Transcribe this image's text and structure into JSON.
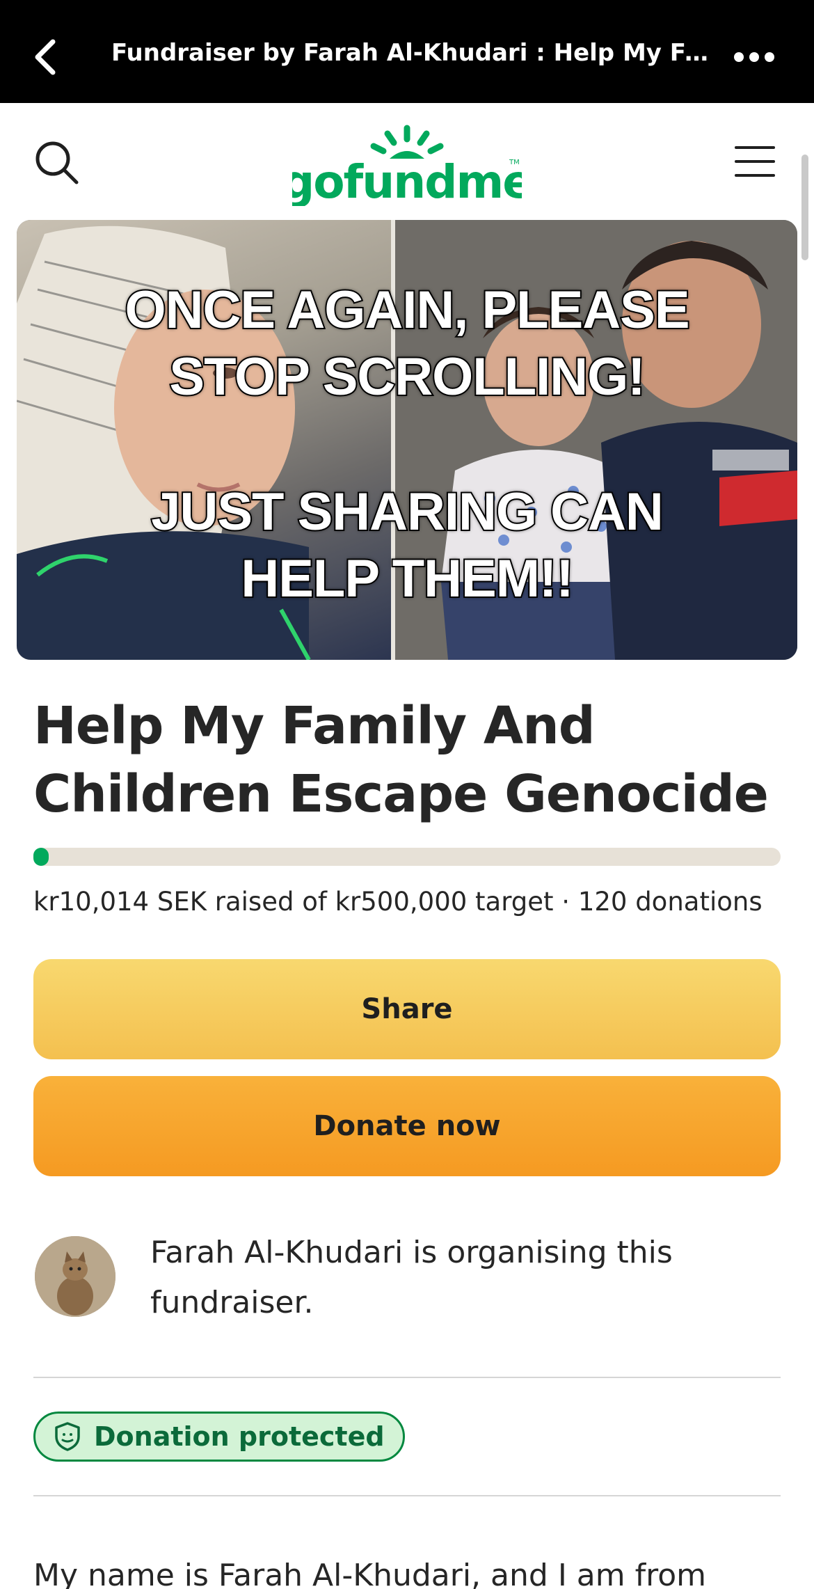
{
  "browser_bar": {
    "title": "Fundraiser by Farah Al-Khudari : Help My Fami...",
    "back_icon": "chevron-left-icon",
    "more_icon": "more-dots-icon"
  },
  "header": {
    "logo_text": "gofundme",
    "logo_tm": "TM",
    "search_icon": "search-icon",
    "menu_icon": "hamburger-menu-icon"
  },
  "hero": {
    "line1": "ONCE AGAIN, PLEASE",
    "line2": "STOP SCROLLING!",
    "line3": "JUST SHARING CAN",
    "line4": "HELP THEM!!"
  },
  "campaign": {
    "title": "Help My Family And Children Escape Genocide",
    "raised_text": "kr10,014 SEK raised of kr500,000 target · 120 donations",
    "progress_fraction": 0.02
  },
  "actions": {
    "share_label": "Share",
    "donate_label": "Donate now"
  },
  "organiser": {
    "text": "Farah Al-Khudari is organising this fundraiser."
  },
  "badge": {
    "label": "Donation protected",
    "icon": "shield-icon"
  },
  "story": {
    "first_line": "My name is Farah Al-Khudari, and I am from"
  },
  "colors": {
    "brand_green": "#02a95c",
    "share_yellow": "#f6cc5e",
    "donate_orange": "#f7a52d",
    "badge_bg": "#d3f3d6"
  }
}
